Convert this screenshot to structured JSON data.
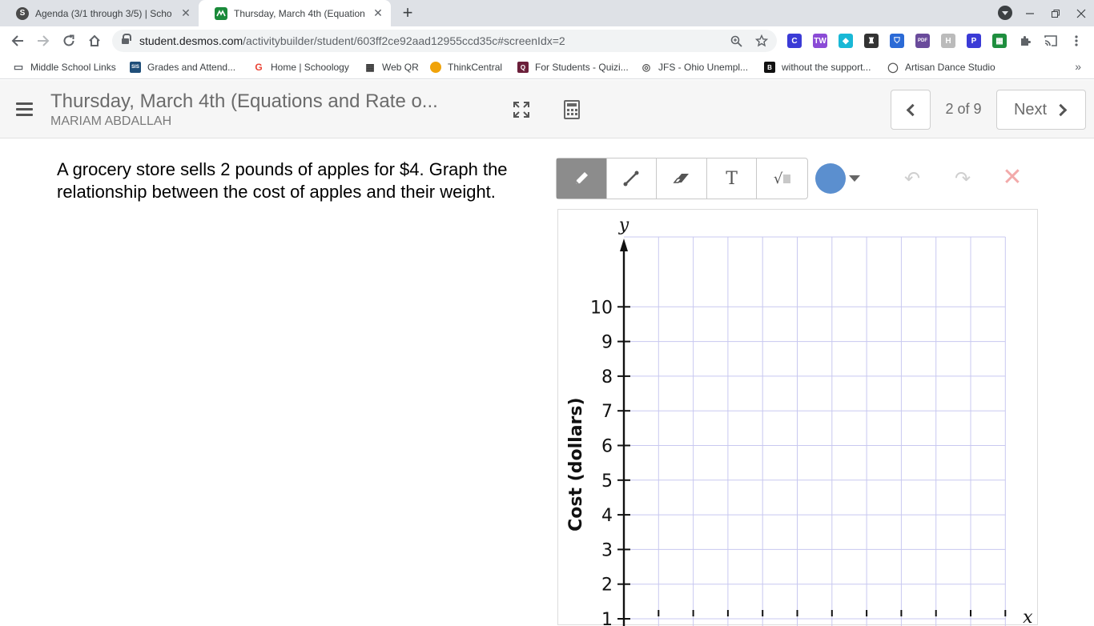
{
  "browser": {
    "tabs": [
      {
        "title": "Agenda (3/1 through 3/5) | Scho",
        "close": "✕",
        "favicon_color": "#4a4a4a",
        "favicon_letter": "S"
      },
      {
        "title": "Thursday, March 4th (Equations",
        "close": "✕",
        "favicon_color": "#1a8a3a",
        "favicon_letter": ""
      }
    ],
    "new_tab": "+",
    "url_host": "student.desmos.com",
    "url_path": "/activitybuilder/student/603ff2ce92aad12955ccd35c#screenIdx=2"
  },
  "extensions": [
    {
      "name": "c-extension-icon",
      "color": "#3b3bd6",
      "letter": "C"
    },
    {
      "name": "tw-extension-icon",
      "color": "#8b4bd6",
      "letter": "TW"
    },
    {
      "name": "diamond-extension-icon",
      "color": "#19b8d6",
      "letter": "◆"
    },
    {
      "name": "spy-extension-icon",
      "color": "#333333",
      "letter": "♜"
    },
    {
      "name": "shield-extension-icon",
      "color": "#2b6ad6",
      "letter": "⛉"
    },
    {
      "name": "pdf-extension-icon",
      "color": "#6a4b9b",
      "letter": "PDF"
    },
    {
      "name": "h-extension-icon",
      "color": "#bbbbbb",
      "letter": "H"
    },
    {
      "name": "p-extension-icon",
      "color": "#3b3bd6",
      "letter": "P"
    },
    {
      "name": "grid-extension-icon",
      "color": "#1e8e3e",
      "letter": "▦"
    }
  ],
  "bookmarks": [
    {
      "label": "Middle School Links",
      "icon_color": "#5f6368",
      "icon_letter": "▭"
    },
    {
      "label": "Grades and Attend...",
      "icon_color": "#1f4e79",
      "icon_letter": "SIS"
    },
    {
      "label": "Home | Schoology",
      "icon_color": "#ea4335",
      "icon_letter": "G"
    },
    {
      "label": "Web QR",
      "icon_color": "#333333",
      "icon_letter": "▦"
    },
    {
      "label": "ThinkCentral",
      "icon_color": "#f0a30a",
      "icon_letter": ""
    },
    {
      "label": "For Students - Quizi...",
      "icon_color": "#6b1f3a",
      "icon_letter": "Q"
    },
    {
      "label": "JFS - Ohio Unempl...",
      "icon_color": "#555555",
      "icon_letter": "◎"
    },
    {
      "label": "without the support...",
      "icon_color": "#111111",
      "icon_letter": "B"
    },
    {
      "label": "Artisan Dance Studio",
      "icon_color": "#555555",
      "icon_letter": "◯"
    }
  ],
  "bookmarks_more": "»",
  "header": {
    "activity_title": "Thursday, March 4th (Equations and Rate o...",
    "student_name": "MARIAM ABDALLAH",
    "screen_count": "2 of 9",
    "next_label": "Next"
  },
  "prompt": "A grocery store sells 2 pounds of apples for $4.  Graph the relationship between the cost of apples and their weight.",
  "sketch": {
    "tool_text": "T",
    "tool_math": "√",
    "undo": "↶",
    "redo": "↷",
    "clear": "✕",
    "pen_color": "#5b8fcf"
  },
  "chart_data": {
    "type": "line",
    "title": "",
    "xlabel": "",
    "ylabel": "Cost (dollars)",
    "y_axis_var": "y",
    "x_axis_var": "x",
    "ylim": [
      0,
      11
    ],
    "y_ticks": [
      1,
      2,
      3,
      4,
      5,
      6,
      7,
      8,
      9,
      10
    ],
    "x_gridlines": 11,
    "grid": true,
    "grid_color": "#c8c8f0",
    "series": []
  }
}
